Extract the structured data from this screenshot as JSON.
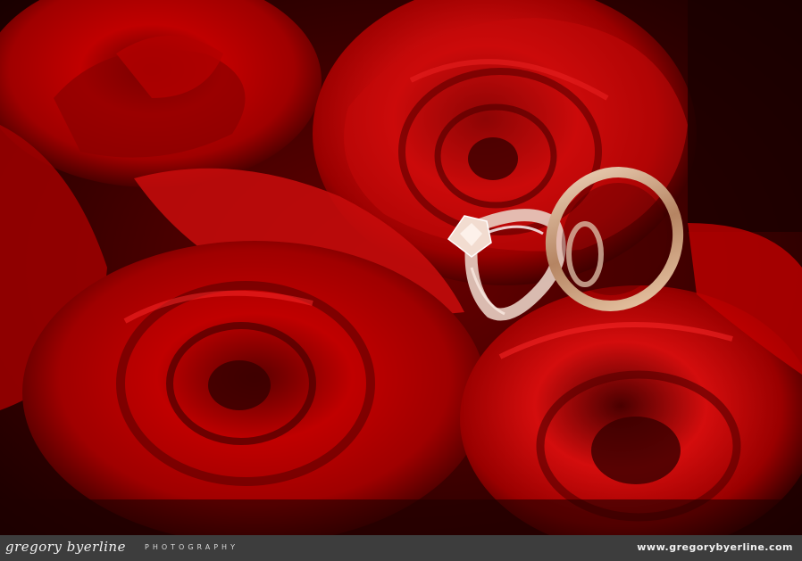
{
  "photo": {
    "subject": "wedding-rings-on-red-roses",
    "colors": {
      "rose": "#b00000",
      "rose_highlight": "#e81a1a",
      "shadow": "#1a0000",
      "gold": "#d9b08c",
      "diamond": "#f2dcd0"
    }
  },
  "footer": {
    "brand_name": "gregory byerline",
    "brand_sub": "PHOTOGRAPHY",
    "url": "www.gregorybyerline.com",
    "colors": {
      "bar": "#3d3d3d",
      "text": "#f0f0f0"
    }
  }
}
